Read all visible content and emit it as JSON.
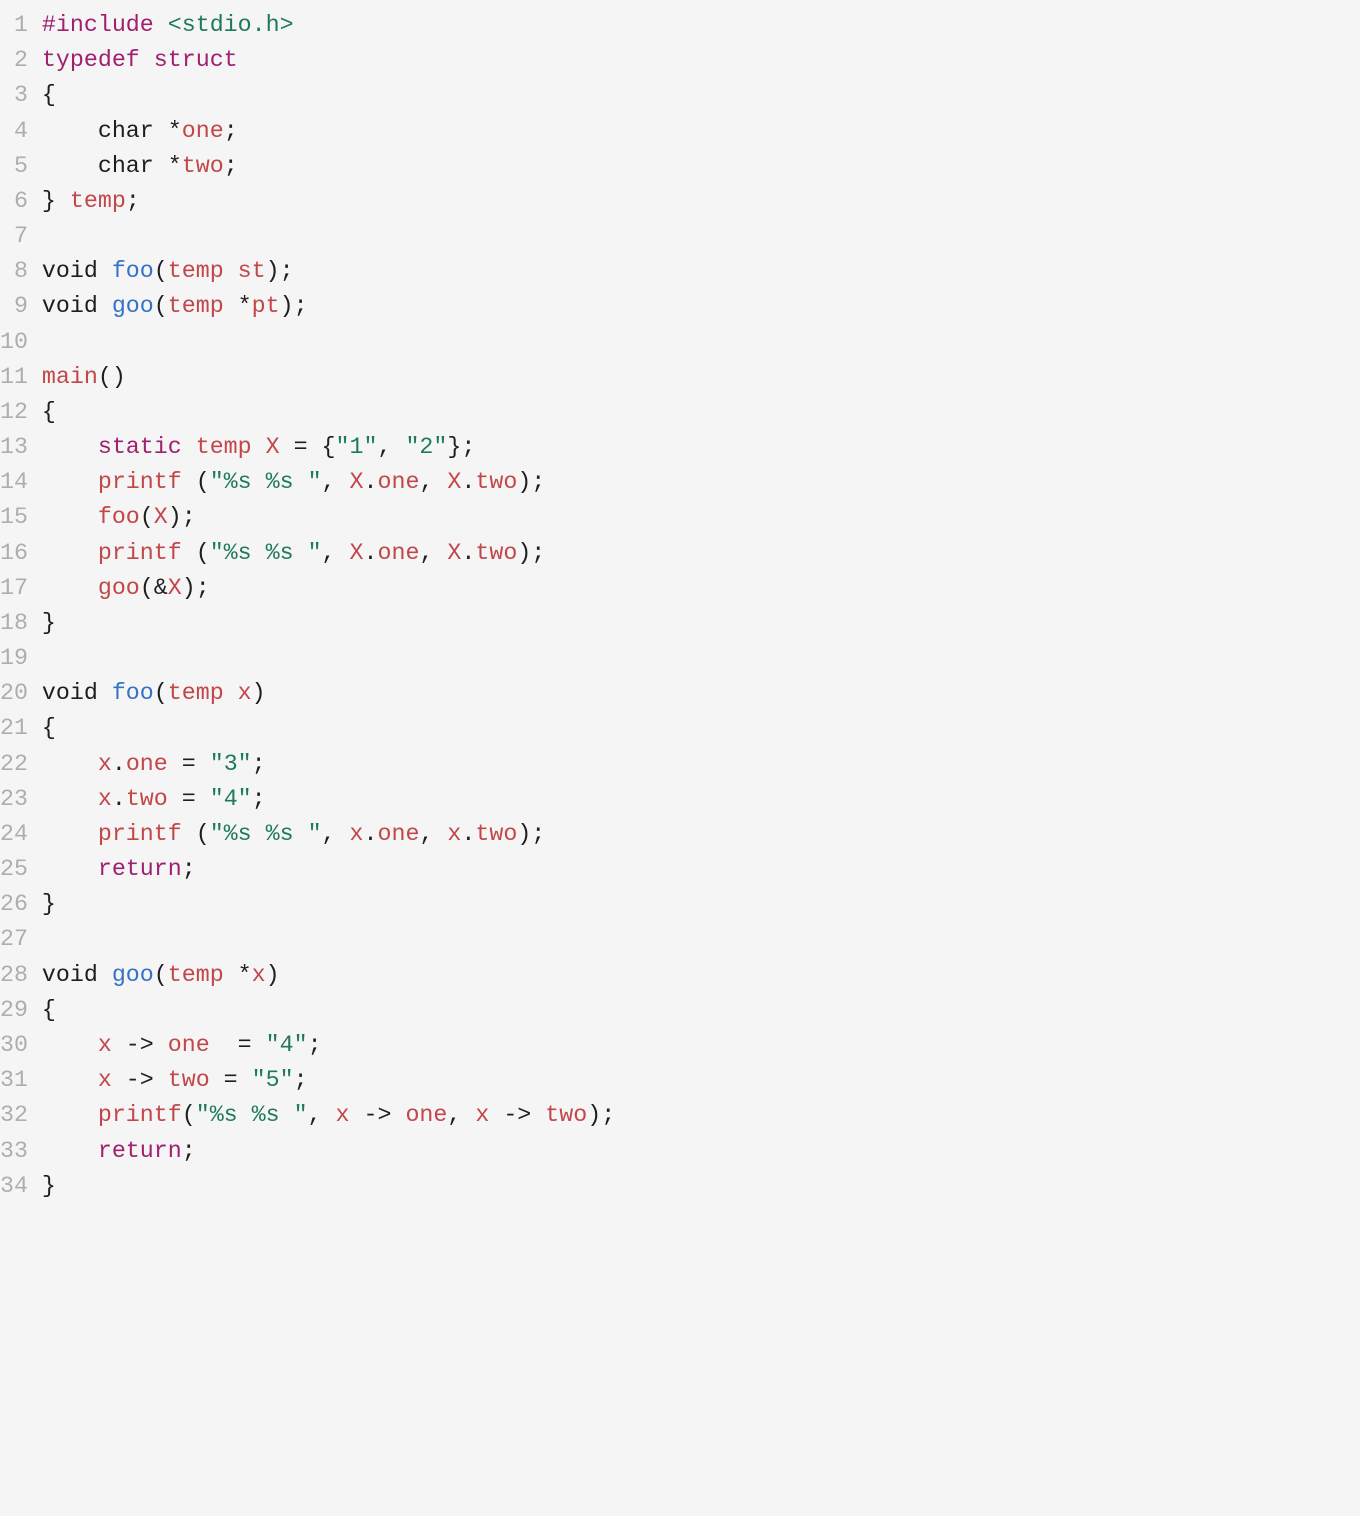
{
  "lines": [
    {
      "n": "1",
      "tokens": [
        {
          "c": "pp",
          "t": "#include"
        },
        {
          "c": "pl",
          "t": " "
        },
        {
          "c": "str",
          "t": "<stdio.h>"
        }
      ]
    },
    {
      "n": "2",
      "tokens": [
        {
          "c": "kw",
          "t": "typedef"
        },
        {
          "c": "pl",
          "t": " "
        },
        {
          "c": "kw",
          "t": "struct"
        }
      ]
    },
    {
      "n": "3",
      "tokens": [
        {
          "c": "pl",
          "t": "{"
        }
      ]
    },
    {
      "n": "4",
      "tokens": [
        {
          "c": "pl",
          "t": "    char *"
        },
        {
          "c": "id",
          "t": "one"
        },
        {
          "c": "pl",
          "t": ";"
        }
      ]
    },
    {
      "n": "5",
      "tokens": [
        {
          "c": "pl",
          "t": "    char *"
        },
        {
          "c": "id",
          "t": "two"
        },
        {
          "c": "pl",
          "t": ";"
        }
      ]
    },
    {
      "n": "6",
      "tokens": [
        {
          "c": "pl",
          "t": "} "
        },
        {
          "c": "ty",
          "t": "temp"
        },
        {
          "c": "pl",
          "t": ";"
        }
      ]
    },
    {
      "n": "7",
      "tokens": []
    },
    {
      "n": "8",
      "tokens": [
        {
          "c": "pl",
          "t": "void "
        },
        {
          "c": "fn",
          "t": "foo"
        },
        {
          "c": "pl",
          "t": "("
        },
        {
          "c": "ty",
          "t": "temp"
        },
        {
          "c": "pl",
          "t": " "
        },
        {
          "c": "id",
          "t": "st"
        },
        {
          "c": "pl",
          "t": ");"
        }
      ]
    },
    {
      "n": "9",
      "tokens": [
        {
          "c": "pl",
          "t": "void "
        },
        {
          "c": "fn",
          "t": "goo"
        },
        {
          "c": "pl",
          "t": "("
        },
        {
          "c": "ty",
          "t": "temp"
        },
        {
          "c": "pl",
          "t": " *"
        },
        {
          "c": "id",
          "t": "pt"
        },
        {
          "c": "pl",
          "t": ");"
        }
      ]
    },
    {
      "n": "10",
      "tokens": []
    },
    {
      "n": "11",
      "tokens": [
        {
          "c": "id",
          "t": "main"
        },
        {
          "c": "pl",
          "t": "()"
        }
      ]
    },
    {
      "n": "12",
      "tokens": [
        {
          "c": "pl",
          "t": "{"
        }
      ]
    },
    {
      "n": "13",
      "tokens": [
        {
          "c": "pl",
          "t": "    "
        },
        {
          "c": "kw",
          "t": "static"
        },
        {
          "c": "pl",
          "t": " "
        },
        {
          "c": "ty",
          "t": "temp"
        },
        {
          "c": "pl",
          "t": " "
        },
        {
          "c": "id",
          "t": "X"
        },
        {
          "c": "pl",
          "t": " = {"
        },
        {
          "c": "str",
          "t": "\"1\""
        },
        {
          "c": "pl",
          "t": ", "
        },
        {
          "c": "str",
          "t": "\"2\""
        },
        {
          "c": "pl",
          "t": "};"
        }
      ]
    },
    {
      "n": "14",
      "tokens": [
        {
          "c": "pl",
          "t": "    "
        },
        {
          "c": "id",
          "t": "printf"
        },
        {
          "c": "pl",
          "t": " ("
        },
        {
          "c": "str",
          "t": "\"%s %s \""
        },
        {
          "c": "pl",
          "t": ", "
        },
        {
          "c": "id",
          "t": "X"
        },
        {
          "c": "pl",
          "t": "."
        },
        {
          "c": "id",
          "t": "one"
        },
        {
          "c": "pl",
          "t": ", "
        },
        {
          "c": "id",
          "t": "X"
        },
        {
          "c": "pl",
          "t": "."
        },
        {
          "c": "id",
          "t": "two"
        },
        {
          "c": "pl",
          "t": ");"
        }
      ]
    },
    {
      "n": "15",
      "tokens": [
        {
          "c": "pl",
          "t": "    "
        },
        {
          "c": "id",
          "t": "foo"
        },
        {
          "c": "pl",
          "t": "("
        },
        {
          "c": "id",
          "t": "X"
        },
        {
          "c": "pl",
          "t": ");"
        }
      ]
    },
    {
      "n": "16",
      "tokens": [
        {
          "c": "pl",
          "t": "    "
        },
        {
          "c": "id",
          "t": "printf"
        },
        {
          "c": "pl",
          "t": " ("
        },
        {
          "c": "str",
          "t": "\"%s %s \""
        },
        {
          "c": "pl",
          "t": ", "
        },
        {
          "c": "id",
          "t": "X"
        },
        {
          "c": "pl",
          "t": "."
        },
        {
          "c": "id",
          "t": "one"
        },
        {
          "c": "pl",
          "t": ", "
        },
        {
          "c": "id",
          "t": "X"
        },
        {
          "c": "pl",
          "t": "."
        },
        {
          "c": "id",
          "t": "two"
        },
        {
          "c": "pl",
          "t": ");"
        }
      ]
    },
    {
      "n": "17",
      "tokens": [
        {
          "c": "pl",
          "t": "    "
        },
        {
          "c": "id",
          "t": "goo"
        },
        {
          "c": "pl",
          "t": "(&"
        },
        {
          "c": "id",
          "t": "X"
        },
        {
          "c": "pl",
          "t": ");"
        }
      ]
    },
    {
      "n": "18",
      "tokens": [
        {
          "c": "pl",
          "t": "}"
        }
      ]
    },
    {
      "n": "19",
      "tokens": []
    },
    {
      "n": "20",
      "tokens": [
        {
          "c": "pl",
          "t": "void "
        },
        {
          "c": "fn",
          "t": "foo"
        },
        {
          "c": "pl",
          "t": "("
        },
        {
          "c": "ty",
          "t": "temp"
        },
        {
          "c": "pl",
          "t": " "
        },
        {
          "c": "id",
          "t": "x"
        },
        {
          "c": "pl",
          "t": ")"
        }
      ]
    },
    {
      "n": "21",
      "tokens": [
        {
          "c": "pl",
          "t": "{"
        }
      ]
    },
    {
      "n": "22",
      "tokens": [
        {
          "c": "pl",
          "t": "    "
        },
        {
          "c": "id",
          "t": "x"
        },
        {
          "c": "pl",
          "t": "."
        },
        {
          "c": "id",
          "t": "one"
        },
        {
          "c": "pl",
          "t": " = "
        },
        {
          "c": "str",
          "t": "\"3\""
        },
        {
          "c": "pl",
          "t": ";"
        }
      ]
    },
    {
      "n": "23",
      "tokens": [
        {
          "c": "pl",
          "t": "    "
        },
        {
          "c": "id",
          "t": "x"
        },
        {
          "c": "pl",
          "t": "."
        },
        {
          "c": "id",
          "t": "two"
        },
        {
          "c": "pl",
          "t": " = "
        },
        {
          "c": "str",
          "t": "\"4\""
        },
        {
          "c": "pl",
          "t": ";"
        }
      ]
    },
    {
      "n": "24",
      "tokens": [
        {
          "c": "pl",
          "t": "    "
        },
        {
          "c": "id",
          "t": "printf"
        },
        {
          "c": "pl",
          "t": " ("
        },
        {
          "c": "str",
          "t": "\"%s %s \""
        },
        {
          "c": "pl",
          "t": ", "
        },
        {
          "c": "id",
          "t": "x"
        },
        {
          "c": "pl",
          "t": "."
        },
        {
          "c": "id",
          "t": "one"
        },
        {
          "c": "pl",
          "t": ", "
        },
        {
          "c": "id",
          "t": "x"
        },
        {
          "c": "pl",
          "t": "."
        },
        {
          "c": "id",
          "t": "two"
        },
        {
          "c": "pl",
          "t": ");"
        }
      ]
    },
    {
      "n": "25",
      "tokens": [
        {
          "c": "pl",
          "t": "    "
        },
        {
          "c": "kw",
          "t": "return"
        },
        {
          "c": "pl",
          "t": ";"
        }
      ]
    },
    {
      "n": "26",
      "tokens": [
        {
          "c": "pl",
          "t": "}"
        }
      ]
    },
    {
      "n": "27",
      "tokens": []
    },
    {
      "n": "28",
      "tokens": [
        {
          "c": "pl",
          "t": "void "
        },
        {
          "c": "fn",
          "t": "goo"
        },
        {
          "c": "pl",
          "t": "("
        },
        {
          "c": "ty",
          "t": "temp"
        },
        {
          "c": "pl",
          "t": " *"
        },
        {
          "c": "id",
          "t": "x"
        },
        {
          "c": "pl",
          "t": ")"
        }
      ]
    },
    {
      "n": "29",
      "tokens": [
        {
          "c": "pl",
          "t": "{"
        }
      ]
    },
    {
      "n": "30",
      "tokens": [
        {
          "c": "pl",
          "t": "    "
        },
        {
          "c": "id",
          "t": "x"
        },
        {
          "c": "pl",
          "t": " -> "
        },
        {
          "c": "id",
          "t": "one"
        },
        {
          "c": "pl",
          "t": "  = "
        },
        {
          "c": "str",
          "t": "\"4\""
        },
        {
          "c": "pl",
          "t": ";"
        }
      ]
    },
    {
      "n": "31",
      "tokens": [
        {
          "c": "pl",
          "t": "    "
        },
        {
          "c": "id",
          "t": "x"
        },
        {
          "c": "pl",
          "t": " -> "
        },
        {
          "c": "id",
          "t": "two"
        },
        {
          "c": "pl",
          "t": " = "
        },
        {
          "c": "str",
          "t": "\"5\""
        },
        {
          "c": "pl",
          "t": ";"
        }
      ]
    },
    {
      "n": "32",
      "tokens": [
        {
          "c": "pl",
          "t": "    "
        },
        {
          "c": "id",
          "t": "printf"
        },
        {
          "c": "pl",
          "t": "("
        },
        {
          "c": "str",
          "t": "\"%s %s \""
        },
        {
          "c": "pl",
          "t": ", "
        },
        {
          "c": "id",
          "t": "x"
        },
        {
          "c": "pl",
          "t": " -> "
        },
        {
          "c": "id",
          "t": "one"
        },
        {
          "c": "pl",
          "t": ", "
        },
        {
          "c": "id",
          "t": "x"
        },
        {
          "c": "pl",
          "t": " -> "
        },
        {
          "c": "id",
          "t": "two"
        },
        {
          "c": "pl",
          "t": ");"
        }
      ]
    },
    {
      "n": "33",
      "tokens": [
        {
          "c": "pl",
          "t": "    "
        },
        {
          "c": "kw",
          "t": "return"
        },
        {
          "c": "pl",
          "t": ";"
        }
      ]
    },
    {
      "n": "34",
      "tokens": [
        {
          "c": "pl",
          "t": "}"
        }
      ]
    }
  ]
}
